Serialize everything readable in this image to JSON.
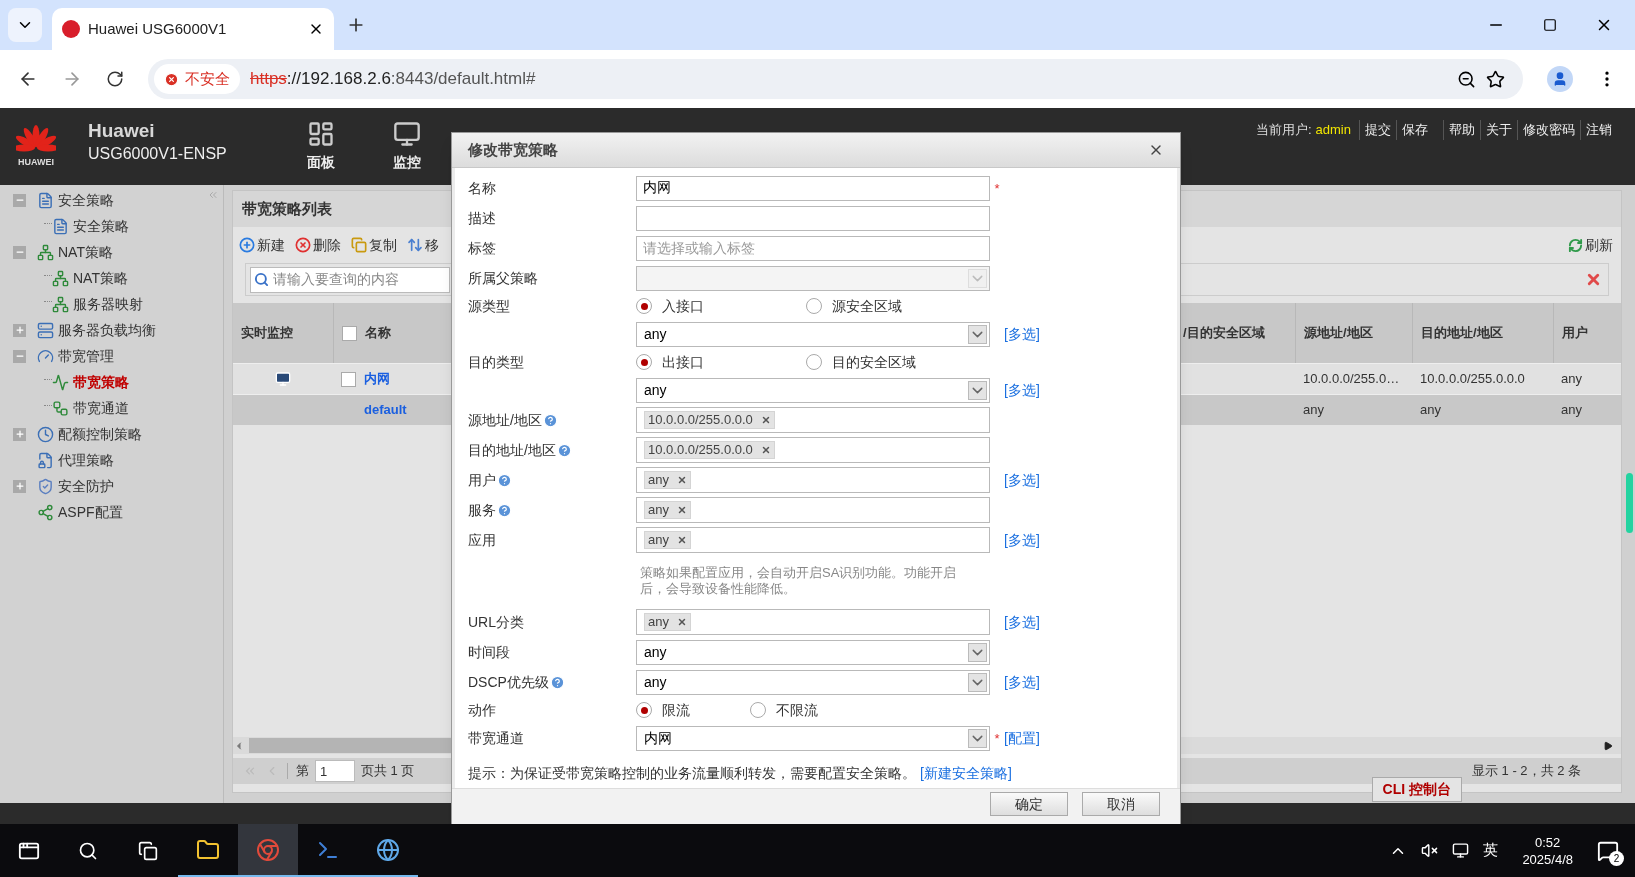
{
  "browser": {
    "tab": {
      "title": "Huawei USG6000V1"
    },
    "security": "不安全",
    "url": {
      "scheme": "https",
      "host": "://192.168.2.6",
      "path": ":8443/default.html#"
    }
  },
  "header": {
    "brand": "Huawei",
    "logo_text": "HUAWEI",
    "model": "USG6000V1-ENSP",
    "nav": [
      {
        "label": "面板",
        "kind": "dashboard"
      },
      {
        "label": "监控",
        "kind": "monitor"
      }
    ],
    "user_label": "当前用户:",
    "user": "admin",
    "actions": [
      "提交",
      "保存",
      "帮助",
      "关于",
      "修改密码",
      "注销"
    ]
  },
  "sidebar": {
    "items": [
      {
        "label": "安全策略",
        "kind": "group",
        "expanded": true,
        "selected": false,
        "children": [
          {
            "label": "安全策略",
            "selected": false
          }
        ]
      },
      {
        "label": "NAT策略",
        "kind": "group",
        "expanded": true,
        "selected": false,
        "children": [
          {
            "label": "NAT策略",
            "selected": false
          },
          {
            "label": "服务器映射",
            "selected": false
          }
        ]
      },
      {
        "label": "服务器负载均衡",
        "kind": "group",
        "expanded": false,
        "selected": false
      },
      {
        "label": "带宽管理",
        "kind": "group",
        "expanded": true,
        "selected": false,
        "children": [
          {
            "label": "带宽策略",
            "selected": true
          },
          {
            "label": "带宽通道",
            "selected": false
          }
        ]
      },
      {
        "label": "配额控制策略",
        "kind": "group",
        "expanded": false,
        "selected": false
      },
      {
        "label": "代理策略",
        "kind": "leaf",
        "selected": false
      },
      {
        "label": "安全防护",
        "kind": "group",
        "expanded": false,
        "selected": false
      },
      {
        "label": "ASPF配置",
        "kind": "leaf",
        "selected": false
      }
    ]
  },
  "panel": {
    "title": "带宽策略列表",
    "toolbar": [
      {
        "label": "新建",
        "kind": "add"
      },
      {
        "label": "删除",
        "kind": "delete"
      },
      {
        "label": "复制",
        "kind": "copy"
      },
      {
        "label": "移",
        "kind": "move"
      }
    ],
    "refresh": "刷新",
    "search": {
      "placeholder": "请输入要查询的内容"
    },
    "table": {
      "columns": [
        "实时监控",
        "名称",
        "/目的安全区域",
        "源地址/地区",
        "目的地址/地区",
        "用户"
      ],
      "header_checked": false,
      "rows": [
        {
          "kind": "policy",
          "checked": false,
          "name": "内网",
          "source": "10.0.0.0/255.0…",
          "destination": "10.0.0.0/255.0.0.0",
          "user": "any",
          "selected": false
        },
        {
          "kind": "default",
          "name": "default",
          "source": "any",
          "destination": "any",
          "user": "any",
          "selected": true
        }
      ]
    },
    "pager": {
      "page_label": "第",
      "page": "1",
      "total": "页共 1 页",
      "summary": "显示 1 - 2，共 2 条"
    }
  },
  "console_tab": "CLI 控制台",
  "dialog": {
    "title": "修改带宽策略",
    "fields": [
      {
        "kind": "text",
        "label": "名称",
        "value": "内网",
        "required": true,
        "help": false
      },
      {
        "kind": "text",
        "label": "描述",
        "required": false,
        "help": false
      },
      {
        "kind": "text",
        "label": "标签",
        "placeholder": "请选择或输入标签",
        "required": false,
        "help": false
      },
      {
        "kind": "select",
        "label": "所属父策略",
        "disabled": true,
        "required": false,
        "help": false
      },
      {
        "kind": "radio",
        "label": "源类型",
        "options": [
          {
            "label": "入接口",
            "selected": true
          },
          {
            "label": "源安全区域",
            "selected": false
          }
        ]
      },
      {
        "kind": "select",
        "value": "any",
        "disabled": false,
        "link": "[多选]"
      },
      {
        "kind": "radio",
        "label": "目的类型",
        "options": [
          {
            "label": "出接口",
            "selected": true
          },
          {
            "label": "目的安全区域",
            "selected": false
          }
        ]
      },
      {
        "kind": "select",
        "value": "any",
        "disabled": false,
        "link": "[多选]"
      },
      {
        "kind": "tags",
        "label": "源地址/地区",
        "tags": [
          "10.0.0.0/255.0.0.0"
        ],
        "required": false,
        "help": true
      },
      {
        "kind": "tags",
        "label": "目的地址/地区",
        "tags": [
          "10.0.0.0/255.0.0.0"
        ],
        "required": false,
        "help": true
      },
      {
        "kind": "tags",
        "label": "用户",
        "tags": [
          "any"
        ],
        "required": false,
        "help": true,
        "link": "[多选]"
      },
      {
        "kind": "tags",
        "label": "服务",
        "tags": [
          "any"
        ],
        "required": false,
        "help": true
      },
      {
        "kind": "tags",
        "label": "应用",
        "tags": [
          "any"
        ],
        "required": false,
        "help": false,
        "link": "[多选]"
      },
      {
        "kind": "note",
        "text": "策略如果配置应用，会自动开启SA识别功能。功能开启后，会导致设备性能降低。"
      },
      {
        "kind": "tags",
        "label": "URL分类",
        "tags": [
          "any"
        ],
        "required": false,
        "help": false,
        "link": "[多选]"
      },
      {
        "kind": "select",
        "label": "时间段",
        "value": "any",
        "disabled": false,
        "required": false,
        "help": false
      },
      {
        "kind": "select",
        "label": "DSCP优先级",
        "value": "any",
        "disabled": false,
        "required": false,
        "help": true,
        "link": "[多选]"
      },
      {
        "kind": "radio",
        "label": "动作",
        "options": [
          {
            "label": "限流",
            "selected": true
          },
          {
            "label": "不限流",
            "selected": false
          }
        ]
      },
      {
        "kind": "select",
        "label": "带宽通道",
        "value": "内网",
        "disabled": false,
        "required": true,
        "help": false,
        "link": "[配置]"
      }
    ],
    "required_mark": "*",
    "hint": "提示：为保证受带宽策略控制的业务流量顺利转发，需要配置安全策略。",
    "hint_link": "[新建安全策略]",
    "buttons": [
      "确定",
      "取消"
    ]
  },
  "taskbar": {
    "apps": [
      {
        "kind": "explorer",
        "selected": false
      },
      {
        "kind": "chrome",
        "selected": true
      },
      {
        "kind": "powershell",
        "selected": false
      },
      {
        "kind": "ensp",
        "selected": false
      }
    ],
    "ime": "英",
    "time": "0:52",
    "date": "2025/4/8",
    "notifications": "2"
  }
}
